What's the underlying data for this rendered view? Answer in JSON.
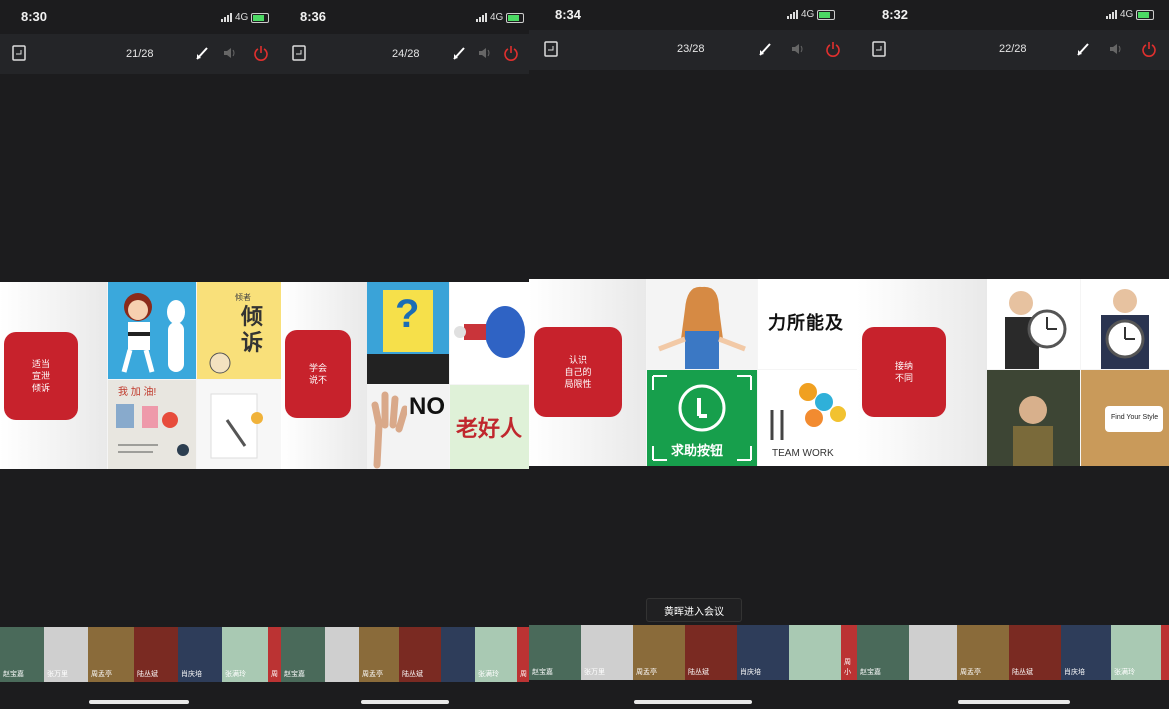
{
  "panels": [
    {
      "time": "8:30",
      "network": "4G",
      "page": "21/28",
      "slide_label": "适当\n宣泄\n倾诉",
      "thumbs": [
        {
          "name": "赵宝嘉"
        },
        {
          "name": "张万里"
        },
        {
          "name": "周孟亭"
        },
        {
          "name": "陆丛斌"
        },
        {
          "name": "肖庆培"
        },
        {
          "name": "张满玲"
        },
        {
          "name": "周"
        }
      ]
    },
    {
      "time": "8:36",
      "network": "4G",
      "page": "24/28",
      "slide_label": "学会\n说不",
      "thumbs": [
        {
          "name": "赵宝嘉"
        },
        {
          "name": "周孟亭"
        },
        {
          "name": "陆丛斌"
        },
        {
          "name": "张满玲"
        },
        {
          "name": "周"
        }
      ]
    },
    {
      "time": "8:34",
      "network": "4G",
      "page": "23/28",
      "slide_label": "认识\n自己的\n局限性",
      "thumbs": [
        {
          "name": "赵宝嘉"
        },
        {
          "name": "张万里"
        },
        {
          "name": "周孟亭"
        },
        {
          "name": "陆丛斌"
        },
        {
          "name": "肖庆培"
        },
        {
          "name": "周小"
        }
      ]
    },
    {
      "time": "8:32",
      "network": "4G",
      "page": "22/28",
      "slide_label": "接纳\n不同",
      "thumbs": [
        {
          "name": "赵宝嘉"
        },
        {
          "name": "周孟亭"
        },
        {
          "name": "陆丛斌"
        },
        {
          "name": "肖庆培"
        },
        {
          "name": "张满玲"
        }
      ]
    }
  ],
  "slide_text": {
    "qingsu": "倾诉",
    "qingsu_small": "倾者",
    "wojia": "我 加 油!",
    "no": "NO",
    "laohaoren": "老好人",
    "qmark": "?",
    "lisuo": "力所能及",
    "qiuzhu": "求助按钮",
    "teamwork": "TEAM WORK",
    "findstyle": "Find Your Style"
  },
  "toast": "黄晖进入会议",
  "icons": {
    "exit": "share-screen-icon",
    "pen": "annotate-pen-icon",
    "speaker": "speaker-icon",
    "power": "power-icon"
  },
  "colors": {
    "accent_red": "#c7222c",
    "power_red": "#e0302e"
  }
}
